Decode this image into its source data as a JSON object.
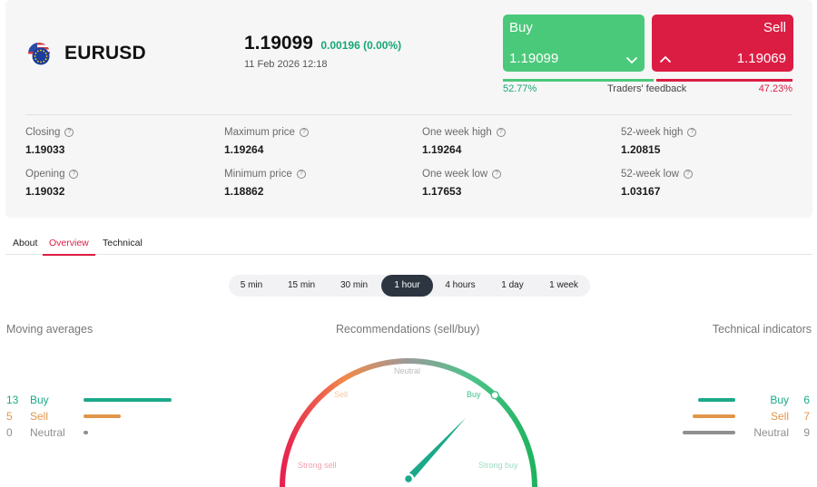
{
  "instrument": {
    "symbol": "EURUSD",
    "price": "1.19099",
    "change": "0.00196 (0.00%)",
    "datetime": "11 Feb 2026 12:18"
  },
  "trade": {
    "buy_label": "Buy",
    "buy_price": "1.19099",
    "sell_label": "Sell",
    "sell_price": "1.19069"
  },
  "feedback": {
    "buy_pct": "52.77%",
    "sell_pct": "47.23%",
    "label": "Traders' feedback",
    "buy_fraction": 0.5277
  },
  "stats": {
    "closing": {
      "label": "Closing",
      "value": "1.19033"
    },
    "opening": {
      "label": "Opening",
      "value": "1.19032"
    },
    "max_price": {
      "label": "Maximum price",
      "value": "1.19264"
    },
    "min_price": {
      "label": "Minimum price",
      "value": "1.18862"
    },
    "week_high": {
      "label": "One week high",
      "value": "1.19264"
    },
    "week_low": {
      "label": "One week low",
      "value": "1.17653"
    },
    "y52_high": {
      "label": "52-week high",
      "value": "1.20815"
    },
    "y52_low": {
      "label": "52-week low",
      "value": "1.03167"
    }
  },
  "tabs": {
    "about": "About",
    "overview": "Overview",
    "technical": "Technical",
    "active": "overview"
  },
  "periods": {
    "items": [
      "5 min",
      "15 min",
      "30 min",
      "1 hour",
      "4 hours",
      "1 day",
      "1 week"
    ],
    "active": "1 hour"
  },
  "moving_averages": {
    "title": "Moving averages",
    "buy": {
      "count": "13",
      "label": "Buy"
    },
    "sell": {
      "count": "5",
      "label": "Sell"
    },
    "neutral": {
      "count": "0",
      "label": "Neutral"
    }
  },
  "technical_indicators": {
    "title": "Technical indicators",
    "buy": {
      "count": "6",
      "label": "Buy"
    },
    "sell": {
      "count": "7",
      "label": "Sell"
    },
    "neutral": {
      "count": "9",
      "label": "Neutral"
    }
  },
  "recommendations": {
    "title": "Recommendations (sell/buy)",
    "labels": {
      "strong_sell": "Strong sell",
      "sell": "Sell",
      "neutral": "Neutral",
      "buy": "Buy",
      "strong_buy": "Strong buy"
    },
    "needle_level": 0.74
  },
  "colors": {
    "buy": "#4bc97a",
    "sell": "#dc1d43",
    "ma_buy": "#1ba98a",
    "ma_sell": "#e0954a",
    "neutral": "#8f8f8f",
    "active_tab": "#dc1d43"
  },
  "icons": {
    "flag": "eur-usd-flag-icon",
    "info": "info-icon",
    "buy_chevron": "chevron-down-icon",
    "sell_chevron": "chevron-up-icon"
  }
}
